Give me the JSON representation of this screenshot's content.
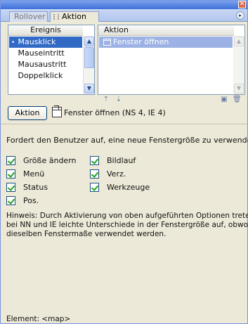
{
  "window": {
    "close_glyph": "✕"
  },
  "tabs": [
    {
      "label": "Rollover",
      "active": false
    },
    {
      "label": "Aktion",
      "active": true
    }
  ],
  "panel_menu_glyph": "▸",
  "events": {
    "header": "Ereignis",
    "items": [
      {
        "label": "Mausklick",
        "selected": true
      },
      {
        "label": "Mauseintritt",
        "selected": false
      },
      {
        "label": "Mausaustritt",
        "selected": false
      },
      {
        "label": "Doppelklick",
        "selected": false
      }
    ]
  },
  "actions": {
    "header": "Aktion",
    "items": [
      {
        "label": "Fenster öffnen",
        "icon": "window-icon",
        "selected": true
      }
    ],
    "toolbar": [
      {
        "name": "move-up-icon",
        "glyph": "⇡"
      },
      {
        "name": "move-down-icon",
        "glyph": "⇣"
      },
      {
        "name": "new-action-icon",
        "glyph": "▣"
      },
      {
        "name": "delete-icon",
        "glyph": "🗑"
      }
    ]
  },
  "action_button_label": "Aktion",
  "action_title": "Fenster öffnen (NS 4, IE 4)",
  "description": "Fordert den Benutzer auf, eine neue Fenstergröße zu verwenden.",
  "options": [
    {
      "label": "Größe ändern",
      "checked": true
    },
    {
      "label": "Bildlauf",
      "checked": true
    },
    {
      "label": "Menü",
      "checked": true
    },
    {
      "label": "Verz.",
      "checked": true
    },
    {
      "label": "Status",
      "checked": true
    },
    {
      "label": "Werkzeuge",
      "checked": true
    },
    {
      "label": "Pos.",
      "checked": true
    }
  ],
  "hint_lines": [
    "Hinweis: Durch Aktivierung von oben aufgeführten Optionen treten",
    "bei NN und IE leichte Unterschiede in der Fenstergröße auf, obwohl",
    "dieselben Fenstermaße verwendet werden."
  ],
  "status": "Element: <map>",
  "colors": {
    "selection": "#316ac5",
    "inactive_selection": "#9db2e4",
    "checkmark": "#21a121",
    "panel_bg": "#ece9d8"
  }
}
